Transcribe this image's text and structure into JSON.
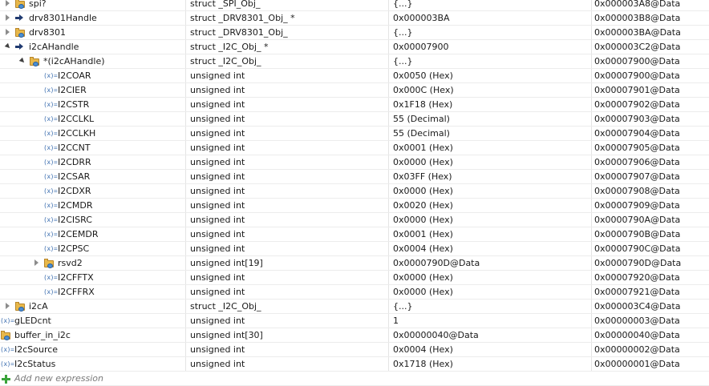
{
  "expressions_view": {
    "rows": [
      {
        "depth": 1,
        "expander": "closed",
        "icon": "folder-struct-icon",
        "name": "spi?",
        "type": "struct _SPI_Obj_",
        "value": "{...}",
        "location": "0x000003A8@Data"
      },
      {
        "depth": 1,
        "expander": "closed",
        "icon": "pointer-arrow-icon",
        "name": "drv8301Handle",
        "type": "struct _DRV8301_Obj_ *",
        "value": "0x000003BA",
        "location": "0x000003B8@Data"
      },
      {
        "depth": 1,
        "expander": "closed",
        "icon": "folder-struct-icon",
        "name": "drv8301",
        "type": "struct _DRV8301_Obj_",
        "value": "{...}",
        "location": "0x000003BA@Data"
      },
      {
        "depth": 1,
        "expander": "open",
        "icon": "pointer-arrow-icon",
        "name": "i2cAHandle",
        "type": "struct _I2C_Obj_ *",
        "value": "0x00007900",
        "location": "0x000003C2@Data"
      },
      {
        "depth": 2,
        "expander": "open",
        "icon": "folder-struct-icon",
        "name": "*(i2cAHandle)",
        "type": "struct _I2C_Obj_",
        "value": "{...}",
        "location": "0x00007900@Data"
      },
      {
        "depth": 3,
        "expander": "none",
        "icon": "variable-icon",
        "name": "I2COAR",
        "type": "unsigned int",
        "value": "0x0050 (Hex)",
        "location": "0x00007900@Data"
      },
      {
        "depth": 3,
        "expander": "none",
        "icon": "variable-icon",
        "name": "I2CIER",
        "type": "unsigned int",
        "value": "0x000C (Hex)",
        "location": "0x00007901@Data"
      },
      {
        "depth": 3,
        "expander": "none",
        "icon": "variable-icon",
        "name": "I2CSTR",
        "type": "unsigned int",
        "value": "0x1F18 (Hex)",
        "location": "0x00007902@Data"
      },
      {
        "depth": 3,
        "expander": "none",
        "icon": "variable-icon",
        "name": "I2CCLKL",
        "type": "unsigned int",
        "value": "55 (Decimal)",
        "location": "0x00007903@Data"
      },
      {
        "depth": 3,
        "expander": "none",
        "icon": "variable-icon",
        "name": "I2CCLKH",
        "type": "unsigned int",
        "value": "55 (Decimal)",
        "location": "0x00007904@Data"
      },
      {
        "depth": 3,
        "expander": "none",
        "icon": "variable-icon",
        "name": "I2CCNT",
        "type": "unsigned int",
        "value": "0x0001 (Hex)",
        "location": "0x00007905@Data"
      },
      {
        "depth": 3,
        "expander": "none",
        "icon": "variable-icon",
        "name": "I2CDRR",
        "type": "unsigned int",
        "value": "0x0000 (Hex)",
        "location": "0x00007906@Data"
      },
      {
        "depth": 3,
        "expander": "none",
        "icon": "variable-icon",
        "name": "I2CSAR",
        "type": "unsigned int",
        "value": "0x03FF (Hex)",
        "location": "0x00007907@Data"
      },
      {
        "depth": 3,
        "expander": "none",
        "icon": "variable-icon",
        "name": "I2CDXR",
        "type": "unsigned int",
        "value": "0x0000 (Hex)",
        "location": "0x00007908@Data"
      },
      {
        "depth": 3,
        "expander": "none",
        "icon": "variable-icon",
        "name": "I2CMDR",
        "type": "unsigned int",
        "value": "0x0020 (Hex)",
        "location": "0x00007909@Data"
      },
      {
        "depth": 3,
        "expander": "none",
        "icon": "variable-icon",
        "name": "I2CISRC",
        "type": "unsigned int",
        "value": "0x0000 (Hex)",
        "location": "0x0000790A@Data"
      },
      {
        "depth": 3,
        "expander": "none",
        "icon": "variable-icon",
        "name": "I2CEMDR",
        "type": "unsigned int",
        "value": "0x0001 (Hex)",
        "location": "0x0000790B@Data"
      },
      {
        "depth": 3,
        "expander": "none",
        "icon": "variable-icon",
        "name": "I2CPSC",
        "type": "unsigned int",
        "value": "0x0004 (Hex)",
        "location": "0x0000790C@Data"
      },
      {
        "depth": 3,
        "expander": "closed",
        "icon": "folder-struct-icon",
        "name": "rsvd2",
        "type": "unsigned int[19]",
        "value": "0x0000790D@Data",
        "location": "0x0000790D@Data"
      },
      {
        "depth": 3,
        "expander": "none",
        "icon": "variable-icon",
        "name": "I2CFFTX",
        "type": "unsigned int",
        "value": "0x0000 (Hex)",
        "location": "0x00007920@Data"
      },
      {
        "depth": 3,
        "expander": "none",
        "icon": "variable-icon",
        "name": "I2CFFRX",
        "type": "unsigned int",
        "value": "0x0000 (Hex)",
        "location": "0x00007921@Data"
      },
      {
        "depth": 1,
        "expander": "closed",
        "icon": "folder-struct-icon",
        "name": "i2cA",
        "type": "struct _I2C_Obj_",
        "value": "{...}",
        "location": "0x000003C4@Data"
      },
      {
        "depth": 0,
        "expander": "none",
        "icon": "variable-icon",
        "name": "gLEDcnt",
        "type": "unsigned int",
        "value": "1",
        "location": "0x00000003@Data"
      },
      {
        "depth": 0,
        "expander": "none",
        "icon": "folder-struct-icon",
        "name": "buffer_in_i2c",
        "type": "unsigned int[30]",
        "value": "0x00000040@Data",
        "location": "0x00000040@Data"
      },
      {
        "depth": 0,
        "expander": "none",
        "icon": "variable-icon",
        "name": "I2cSource",
        "type": "unsigned int",
        "value": "0x0004 (Hex)",
        "location": "0x00000002@Data"
      },
      {
        "depth": 0,
        "expander": "none",
        "icon": "variable-icon",
        "name": "I2cStatus",
        "type": "unsigned int",
        "value": "0x1718 (Hex)",
        "location": "0x00000001@Data"
      },
      {
        "depth": 0,
        "expander": "none",
        "icon": "add-icon",
        "name": "Add new expression",
        "type": "",
        "value": "",
        "location": "",
        "is_add": true
      }
    ],
    "variable_icon_glyph": "(x)=",
    "colors": {
      "grid_line": "#ececec",
      "variable_icon": "#3d6fb0",
      "pointer_icon": "#203a70",
      "folder": "#e8b84a",
      "add": "#3aa33a"
    }
  }
}
